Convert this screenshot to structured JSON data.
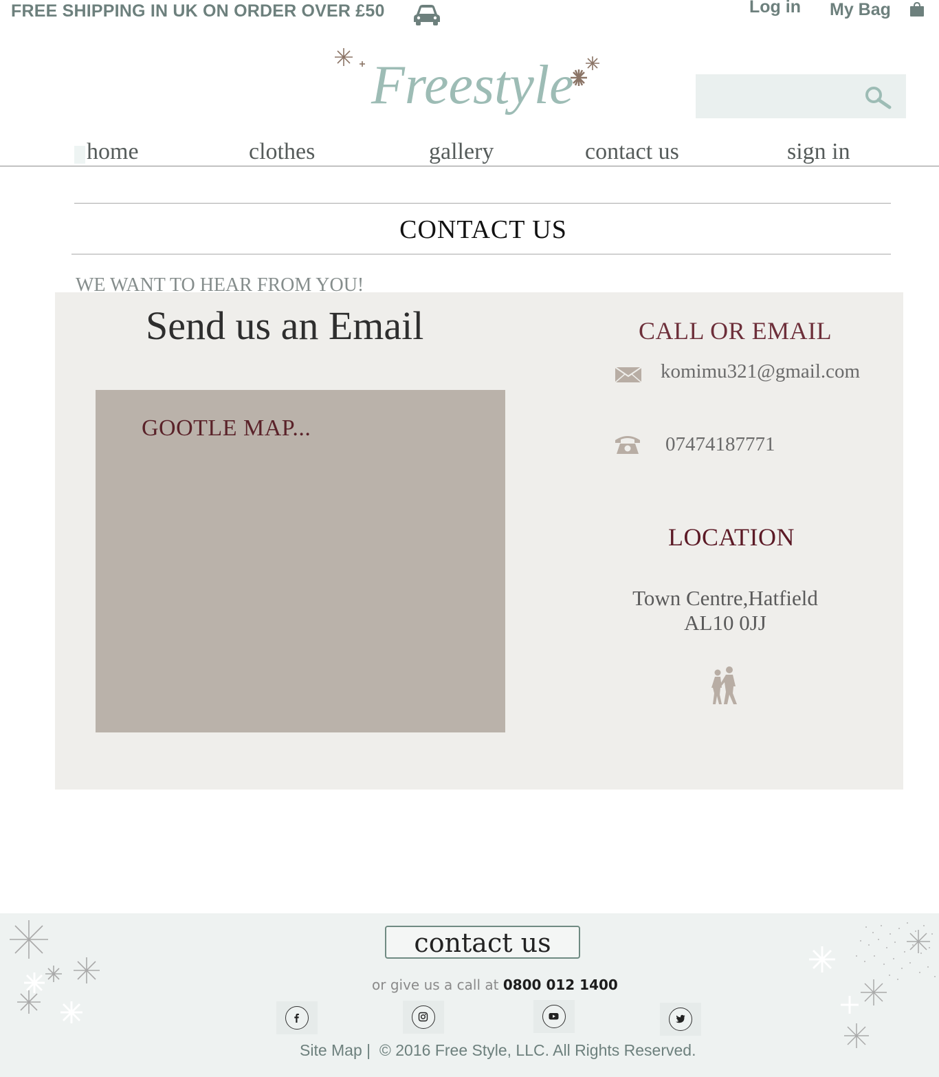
{
  "topbar": {
    "shipping_text": "FREE SHIPPING IN UK ON ORDER OVER £50",
    "shipping_icon": "car-icon",
    "login_label": "Log in",
    "bag_label": "My Bag",
    "bag_icon": "shopping-bag-icon"
  },
  "brand": {
    "logo_text": "Freestyle",
    "logo_color": "#9dbcb5",
    "accent_color": "#8b7466"
  },
  "search": {
    "placeholder": "",
    "icon": "search-icon"
  },
  "nav": {
    "items": [
      {
        "label": "home"
      },
      {
        "label": "clothes"
      },
      {
        "label": "gallery"
      },
      {
        "label": "contact us"
      },
      {
        "label": "sign in"
      }
    ]
  },
  "page": {
    "title": "CONTACT US",
    "subtitle": "WE WANT TO HEAR FROM YOU!"
  },
  "contact": {
    "send_heading": "Send us an Email",
    "map_label": "GOOTLE MAP...",
    "call_heading": "CALL OR EMAIL",
    "email": "komimu321@gmail.com",
    "phone": "07474187771",
    "location_heading": "LOCATION",
    "address_line1": "Town Centre,Hatfield",
    "address_line2": "AL10 0JJ",
    "panel_color": "#efeeeb",
    "map_color": "#bab2aa",
    "heading_color": "#5c1a26"
  },
  "footer": {
    "contact_button": "contact us",
    "call_prefix": "or give us a call at",
    "call_number": "0800 012 1400",
    "social": [
      "facebook-icon",
      "instagram-icon",
      "youtube-icon",
      "twitter-icon"
    ],
    "sitemap": "Site Map |",
    "copyright": "© 2016 Free Style, LLC. All Rights Reserved."
  }
}
